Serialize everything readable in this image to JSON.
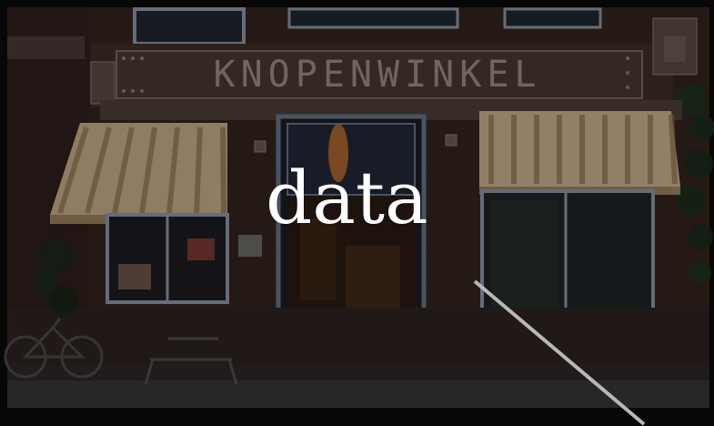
{
  "overlay": {
    "word": "data"
  },
  "sign": {
    "text": "KNOPENWINKEL"
  },
  "colors": {
    "background": "#0b0b0b",
    "brick": "#3a2724",
    "awning_stripe_light": "#c8b08a",
    "awning_stripe_dark": "#8f6f4e",
    "window_frame": "#9aa3b5",
    "overlay_text": "#ffffff"
  }
}
